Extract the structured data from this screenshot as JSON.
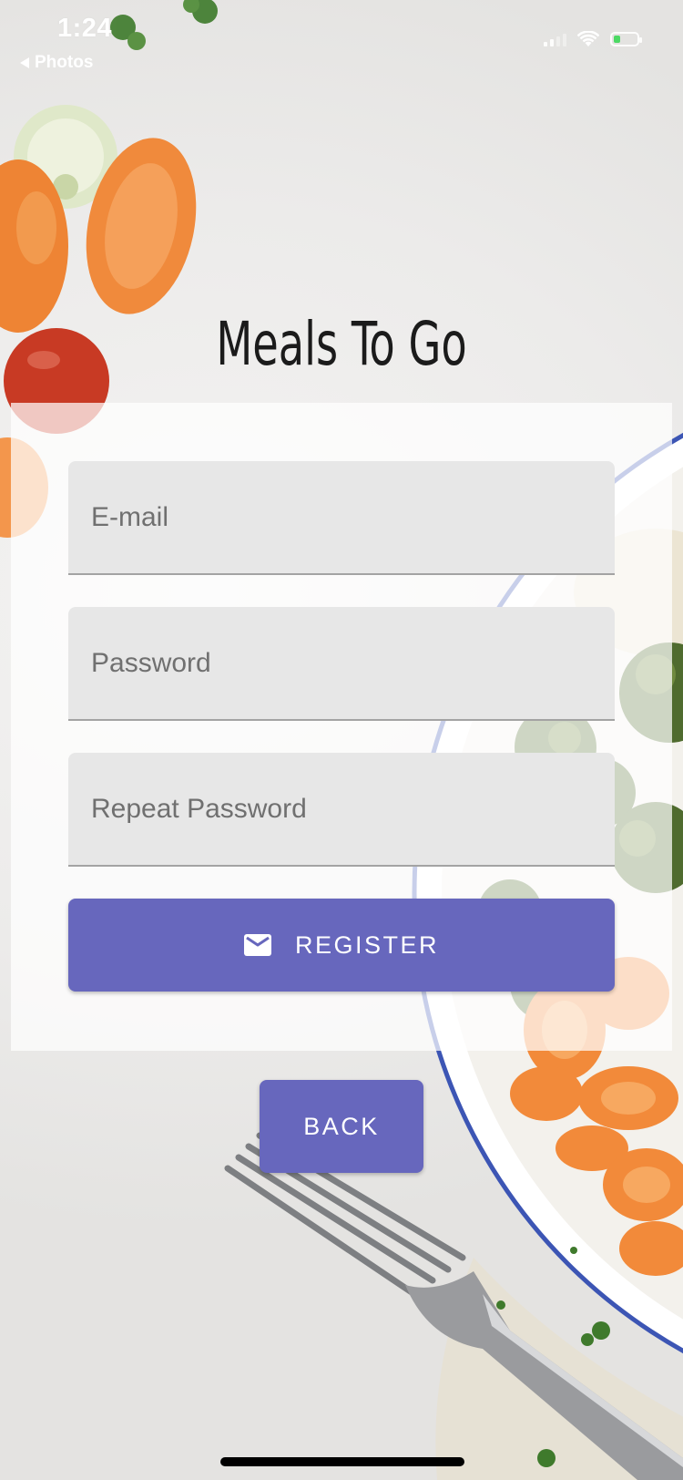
{
  "status_bar": {
    "time": "1:24",
    "back_label": "Photos",
    "battery_level": 0.3
  },
  "app": {
    "title": "Meals To Go"
  },
  "form": {
    "email_placeholder": "E-mail",
    "password_placeholder": "Password",
    "repeat_password_placeholder": "Repeat Password",
    "register_label": "REGISTER",
    "register_icon": "email-icon"
  },
  "nav": {
    "back_label": "BACK"
  },
  "colors": {
    "accent": "#6767bd",
    "field_bg": "#e7e7e7",
    "title": "#1b1b1b"
  }
}
